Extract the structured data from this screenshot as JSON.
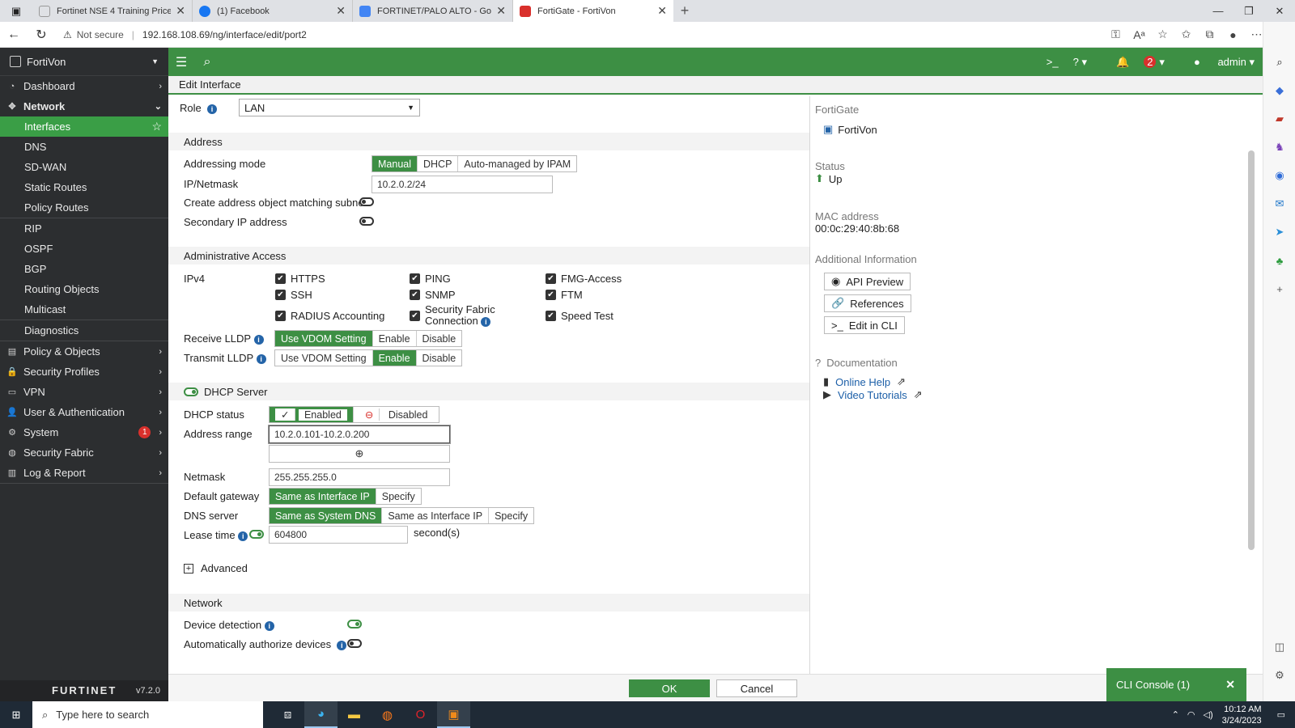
{
  "browser": {
    "tabs": [
      {
        "title": "Fortinet NSE 4 Training Price",
        "fav_color": "#ffffff",
        "active": false
      },
      {
        "title": "(1) Facebook",
        "fav_color": "#1877f2",
        "active": false
      },
      {
        "title": "FORTINET/PALO ALTO - Google D",
        "fav_color": "#4285f4",
        "active": false
      },
      {
        "title": "FortiGate - FortiVon",
        "fav_color": "#d9302c",
        "active": true
      }
    ],
    "not_secure": "Not secure",
    "url": "192.168.108.69/ng/interface/edit/port2"
  },
  "sidebar": {
    "device": "FortiVon",
    "items": [
      {
        "label": "Dashboard",
        "icon": "dashboard-icon",
        "glyph": "◔",
        "chev": "›",
        "type": "top"
      },
      {
        "label": "Network",
        "icon": "network-icon",
        "glyph": "✥",
        "chev": "⌄",
        "type": "top-bold"
      },
      {
        "label": "Interfaces",
        "type": "sub-sel",
        "star": "☆"
      },
      {
        "label": "DNS",
        "type": "sub"
      },
      {
        "label": "SD-WAN",
        "type": "sub"
      },
      {
        "label": "Static Routes",
        "type": "sub"
      },
      {
        "label": "Policy Routes",
        "type": "sub"
      },
      {
        "label": "RIP",
        "type": "sub"
      },
      {
        "label": "OSPF",
        "type": "sub"
      },
      {
        "label": "BGP",
        "type": "sub"
      },
      {
        "label": "Routing Objects",
        "type": "sub"
      },
      {
        "label": "Multicast",
        "type": "sub"
      },
      {
        "label": "Diagnostics",
        "type": "sub"
      },
      {
        "label": "Policy & Objects",
        "icon": "policy-icon",
        "glyph": "▤",
        "chev": "›",
        "type": "top"
      },
      {
        "label": "Security Profiles",
        "icon": "lock-icon",
        "glyph": "🔒",
        "chev": "›",
        "type": "top"
      },
      {
        "label": "VPN",
        "icon": "monitor-icon",
        "glyph": "▭",
        "chev": "›",
        "type": "top"
      },
      {
        "label": "User & Authentication",
        "icon": "user-icon",
        "glyph": "👤",
        "chev": "›",
        "type": "top"
      },
      {
        "label": "System",
        "icon": "gear-icon",
        "glyph": "⚙",
        "chev": "›",
        "badge": "1",
        "type": "top"
      },
      {
        "label": "Security Fabric",
        "icon": "fabric-icon",
        "glyph": "◍",
        "chev": "›",
        "type": "top"
      },
      {
        "label": "Log & Report",
        "icon": "chart-icon",
        "glyph": "▥",
        "chev": "›",
        "type": "top"
      }
    ],
    "brand": "FURTINET",
    "version": "v7.2.0"
  },
  "topbar": {
    "notif_count": "2",
    "user": "admin"
  },
  "page_title": "Edit Interface",
  "form": {
    "role_label": "Role",
    "role_value": "LAN",
    "address_section": "Address",
    "addressing_mode_label": "Addressing mode",
    "addressing_modes": [
      "Manual",
      "DHCP",
      "Auto-managed by IPAM"
    ],
    "ip_label": "IP/Netmask",
    "ip_value": "10.2.0.2/24",
    "create_addr_label": "Create address object matching subnet",
    "secondary_ip_label": "Secondary IP address",
    "admin_section": "Administrative Access",
    "ipv4_label": "IPv4",
    "access": {
      "https": "HTTPS",
      "ping": "PING",
      "fmg": "FMG-Access",
      "ssh": "SSH",
      "snmp": "SNMP",
      "ftm": "FTM",
      "radius": "RADIUS Accounting",
      "fabric_1": "Security Fabric",
      "fabric_2": "Connection",
      "speed": "Speed Test"
    },
    "rx_lldp_label": "Receive LLDP",
    "tx_lldp_label": "Transmit LLDP",
    "lldp_options": [
      "Use VDOM Setting",
      "Enable",
      "Disable"
    ],
    "dhcp_section": "DHCP Server",
    "dhcp_status_label": "DHCP status",
    "dhcp_enabled": "Enabled",
    "dhcp_disabled": "Disabled",
    "range_label": "Address range",
    "range_value": "10.2.0.101-10.2.0.200",
    "netmask_label": "Netmask",
    "netmask_value": "255.255.255.0",
    "gateway_label": "Default gateway",
    "gateway_options": [
      "Same as Interface IP",
      "Specify"
    ],
    "dns_label": "DNS server",
    "dns_options": [
      "Same as System DNS",
      "Same as Interface IP",
      "Specify"
    ],
    "lease_label": "Lease time",
    "lease_value": "604800",
    "lease_unit": "second(s)",
    "advanced": "Advanced",
    "network_section": "Network",
    "device_detect_label": "Device detection",
    "auto_auth_label": "Automatically authorize devices"
  },
  "right": {
    "fortigate_label": "FortiGate",
    "fortigate_name": "FortiVon",
    "status_label": "Status",
    "status_value": "Up",
    "mac_label": "MAC address",
    "mac_value": "00:0c:29:40:8b:68",
    "addl_label": "Additional Information",
    "api_preview": "API Preview",
    "references": "References",
    "edit_cli": "Edit in CLI",
    "doc_label": "Documentation",
    "online_help": "Online Help",
    "video_tutorials": "Video Tutorials"
  },
  "footer": {
    "ok": "OK",
    "cancel": "Cancel",
    "cli_console": "CLI Console (1)"
  },
  "taskbar": {
    "search_placeholder": "Type here to search",
    "time": "10:12 AM",
    "date": "3/24/2023"
  },
  "colors": {
    "accent": "#3d8f44",
    "sidebar": "#2c2e30",
    "badge": "#d9302c"
  }
}
